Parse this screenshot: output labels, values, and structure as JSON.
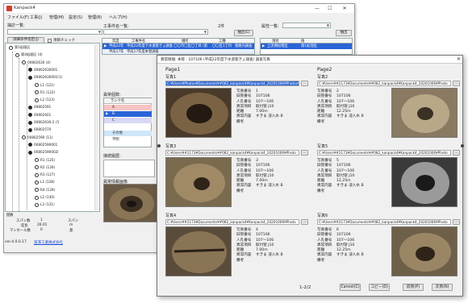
{
  "app": {
    "title": "Kanpack4",
    "menu": [
      "ファイル(F)",
      "工事(J)",
      "管理(M)",
      "設定(S)",
      "管理(B)",
      "ヘルプ(H)"
    ],
    "window_controls": [
      "—",
      "☐",
      "✕"
    ]
  },
  "left": {
    "label": "抽診一覧:",
    "detail_button": "詳細条件指定(J)",
    "check_label": "項目チェック",
    "tree": [
      {
        "text": "第1処理区",
        "level": 0
      },
      {
        "text": "第4処理区 (4)",
        "level": 1
      },
      {
        "text": "00802630 (4)",
        "level": 2
      },
      {
        "text": "00802630001",
        "level": 3
      },
      {
        "text": "00802630001(1)",
        "level": 3
      },
      {
        "text": "L1 (121)",
        "level": 4
      },
      {
        "text": "R1 (122)",
        "level": 4
      },
      {
        "text": "L2 (123)",
        "level": 4
      },
      {
        "text": "00802591",
        "level": 3
      },
      {
        "text": "00802601",
        "level": 3
      },
      {
        "text": "00802630-2 (5",
        "level": 3
      },
      {
        "text": "00802570",
        "level": 3
      },
      {
        "text": "00802590 (11)",
        "level": 2
      },
      {
        "text": "00802590001",
        "level": 3
      },
      {
        "text": "00802590002(",
        "level": 3
      },
      {
        "text": "R1 (125)",
        "level": 4
      },
      {
        "text": "R2 (126)",
        "level": 4
      },
      {
        "text": "R3 (127)",
        "level": 4
      },
      {
        "text": "L1 (128)",
        "level": 4
      },
      {
        "text": "R4 (129)",
        "level": 4
      },
      {
        "text": "L2 (130)",
        "level": 4
      },
      {
        "text": "L3 (131)",
        "level": 4
      }
    ],
    "status": {
      "header": "個数",
      "span_label": "スパン数",
      "span_value": "1",
      "length_label": "延長",
      "length_value": "26.01",
      "unit": "m",
      "manhole_label": "マンホール数",
      "manhole_value": "0",
      "col2_header": "スパン",
      "col2_unit": "基"
    },
    "version": "ver.4.0.0.17",
    "company_link": "富澤工業株式会社"
  },
  "center": {
    "label": "工事件名一覧:",
    "count": "2件",
    "filter_label": "属性一覧:",
    "output_button": "抽出(E)",
    "output_button2": "抽出",
    "columns": [
      "年度",
      "工事件名",
      "場所",
      "工種"
    ],
    "rows": [
      {
        "year": "平成22年",
        "name": "平成22年度下水道管きょ調査 〇〇市〇区〇丁目 (第1工区)",
        "place": "〇〇区1丁目",
        "type": "管路内調査"
      },
      {
        "year": "平成17年",
        "name": "平成17年度本管調査",
        "place": "",
        "type": ""
      }
    ],
    "right_columns": [
      "項目",
      "値"
    ],
    "right_rows": [
      {
        "k": "上流側処理区",
        "v": "第1処理区"
      }
    ],
    "rank_label": "異常個数:",
    "rank_header": "ランク名",
    "ranks": [
      "A",
      "B",
      "C",
      "その他",
      "不明"
    ],
    "memo_label": "接続履歴:",
    "photo_label": "異常情報画像"
  },
  "dialog": {
    "title": "異常情報: 本管 - 107106 (平成22年度下水道管きょ調査) 調査写真",
    "page1": "Page1",
    "page2": "Page2",
    "page_indicator": "1-2/2",
    "buttons": {
      "cancel": "Cancel(C)",
      "copy": "コピー(D)",
      "prev": "前頁(P)",
      "next": "次頁(N)"
    },
    "cards": [
      {
        "title": "写真1",
        "path": "C:¥Users¥Photos¥Documents¥#082_kanpack4¥Kanpack4_20201006¥Photos¥...",
        "selected": true,
        "fields": [
          [
            "写真番号",
            "1"
          ],
          [
            "旧管番号",
            "107106"
          ],
          [
            "人孔番号",
            "107～106"
          ],
          [
            "異常項目",
            "取付管 J10"
          ],
          [
            "距離",
            "7.00m"
          ],
          [
            "異常内容",
            "すきま 浸入水 B"
          ],
          [
            "備考",
            ""
          ]
        ],
        "img": "pipe-dark"
      },
      {
        "title": "写真2",
        "path": "C:¥Users¥#2173¥Documents¥#082_kanpack4¥Kanpack4_20201006¥Photo",
        "selected": false,
        "fields": [
          [
            "写真番号",
            "2"
          ],
          [
            "旧管番号",
            "107106"
          ],
          [
            "人孔番号",
            "107～106"
          ],
          [
            "異常項目",
            "取付管 J10"
          ],
          [
            "距離",
            "12.25m"
          ],
          [
            "異常内容",
            "すきま 浸入水 B"
          ],
          [
            "備考",
            ""
          ]
        ],
        "img": "pipe-joint"
      },
      {
        "title": "写真3",
        "path": "C:¥Users¥#2173¥Documents¥#082_kanpack4¥Kanpack4_20201006¥Photo",
        "selected": false,
        "fields": [
          [
            "写真番号",
            "3"
          ],
          [
            "旧管番号",
            "107106"
          ],
          [
            "人孔番号",
            "107～106"
          ],
          [
            "異常項目",
            "取付管 J10"
          ],
          [
            "距離",
            "7.00m"
          ],
          [
            "異常内容",
            "すきま 浸入水 B"
          ],
          [
            "備考",
            ""
          ]
        ],
        "img": "pipe-rough"
      },
      {
        "title": "写真5",
        "path": "C:¥Users¥#2173¥Documents¥#082_kanpack4¥Kanpack4_20201006¥Photo",
        "selected": false,
        "fields": [
          [
            "写真番号",
            "5"
          ],
          [
            "旧管番号",
            "107106"
          ],
          [
            "人孔番号",
            "107～106"
          ],
          [
            "異常項目",
            "取付管 J10"
          ],
          [
            "距離",
            "12.25m"
          ],
          [
            "異常内容",
            "すきま 浸入水 B"
          ],
          [
            "備考",
            ""
          ]
        ],
        "img": "pipe-round"
      },
      {
        "title": "写真4",
        "path": "C:¥Users¥#2173¥Documents¥#082_kanpack4¥Kanpack4_20201006¥Photo",
        "selected": false,
        "fields": [
          [
            "写真番号",
            "4"
          ],
          [
            "旧管番号",
            "107106"
          ],
          [
            "人孔番号",
            "107～106"
          ],
          [
            "異常項目",
            "取付管 J10"
          ],
          [
            "距離",
            "7.00m"
          ],
          [
            "異常内容",
            "すきま 浸入水 B"
          ],
          [
            "備考",
            ""
          ]
        ],
        "img": "pipe-crack"
      },
      {
        "title": "写真6",
        "path": "C:¥Users¥#2173¥Documents¥#082_kanpack4¥Kanpack4_20201006¥Photo",
        "selected": false,
        "fields": [
          [
            "写真番号",
            "6"
          ],
          [
            "旧管番号",
            "107106"
          ],
          [
            "人孔番号",
            "107～106"
          ],
          [
            "異常項目",
            "取付管 J10"
          ],
          [
            "距離",
            "12.25m"
          ],
          [
            "異常内容",
            "すきま 浸入水 B"
          ],
          [
            "備考",
            ""
          ]
        ],
        "img": "pipe-mud"
      }
    ]
  },
  "colors": {
    "selection": "#2a64d6",
    "rank_a": "#e88",
    "rank_b": "#99c",
    "rank_other": "#9cf",
    "link": "#1a4fd8"
  }
}
